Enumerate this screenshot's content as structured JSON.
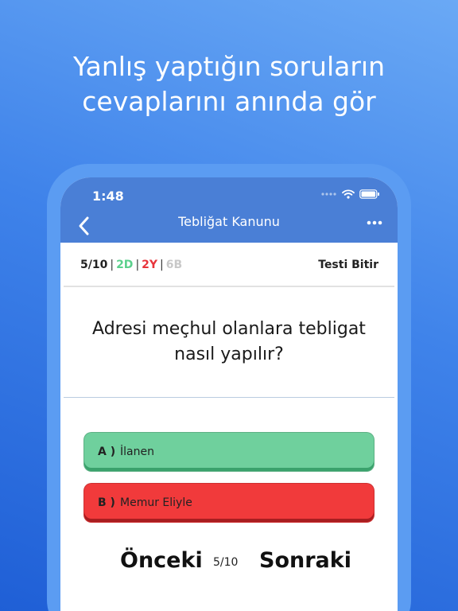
{
  "headline": {
    "line1": "Yanlış yaptığın soruların",
    "line2": "cevaplarını anında gör"
  },
  "statusbar": {
    "time": "1:48",
    "icons": [
      "signal-dots-icon",
      "wifi-icon",
      "battery-icon"
    ]
  },
  "navbar": {
    "title": "Tebliğat Kanunu",
    "back_icon": "chevron-left-icon",
    "more_icon": "more-horizontal-icon"
  },
  "progress": {
    "total": "5/10",
    "correct": "2D",
    "wrong": "2Y",
    "empty": "6B",
    "separator": "|",
    "end_test_label": "Testi Bitir",
    "colors": {
      "correct": "#5bd08c",
      "wrong": "#e8343b",
      "empty": "#c8c8c8"
    }
  },
  "question": {
    "text": "Adresi meçhul olanlara tebligat nasıl yapılır?"
  },
  "options": [
    {
      "letter": "A )",
      "text": "İlanen",
      "state": "correct",
      "color": "#6fd09d"
    },
    {
      "letter": "B )",
      "text": "Memur Eliyle",
      "state": "wrong",
      "color": "#f13a3b"
    }
  ],
  "footer": {
    "prev_label": "Önceki",
    "page": "5/10",
    "next_label": "Sonraki"
  },
  "colors": {
    "background_top": "#6aa9f5",
    "background_bottom": "#1f5fd6",
    "navbar": "#4a7fd6",
    "phone_frame": "#5b9cf2"
  }
}
